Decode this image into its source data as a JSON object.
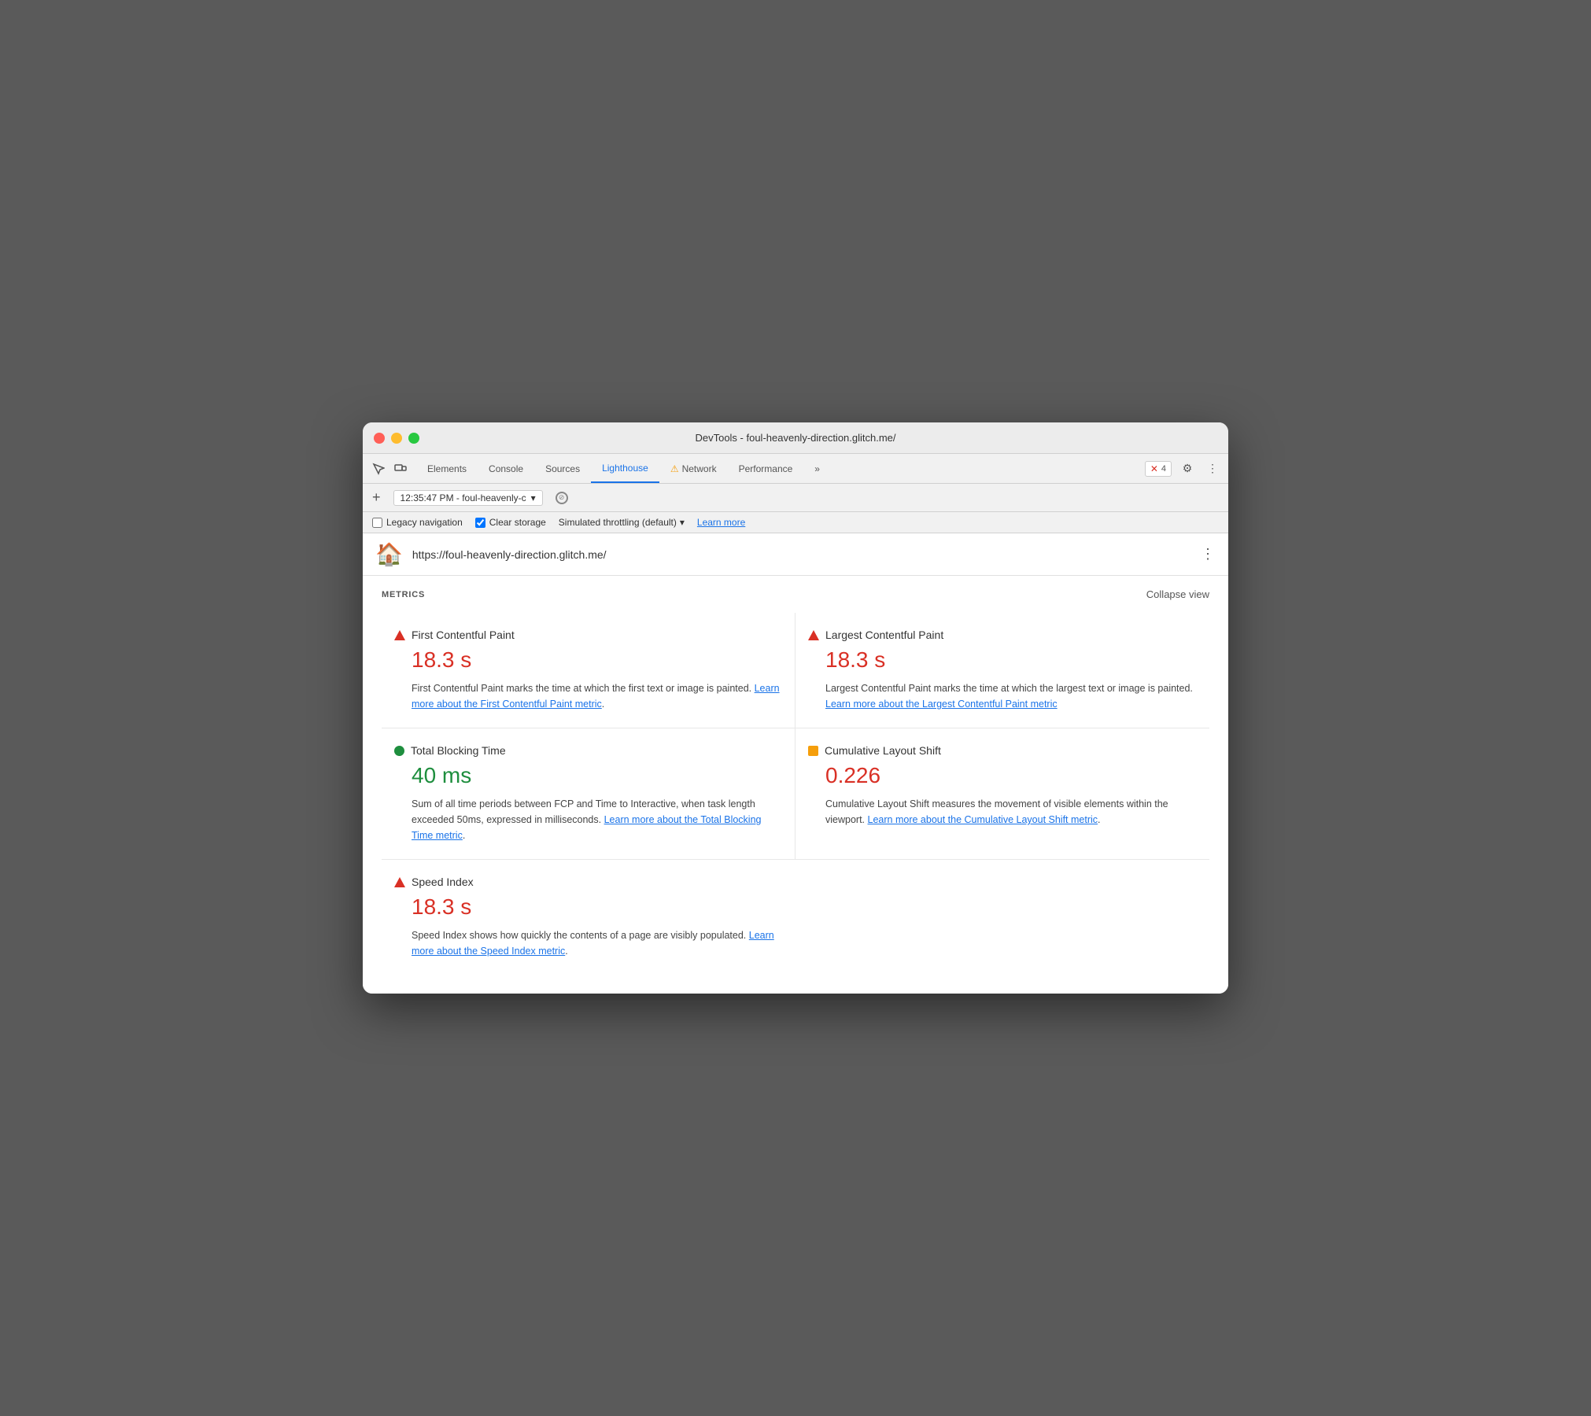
{
  "window": {
    "title": "DevTools - foul-heavenly-direction.glitch.me/"
  },
  "tabs": {
    "items": [
      {
        "label": "Elements",
        "active": false
      },
      {
        "label": "Console",
        "active": false
      },
      {
        "label": "Sources",
        "active": false
      },
      {
        "label": "Lighthouse",
        "active": true
      },
      {
        "label": "Network",
        "active": false,
        "warning": true
      },
      {
        "label": "Performance",
        "active": false
      },
      {
        "label": "»",
        "active": false
      }
    ],
    "error_count": "4"
  },
  "toolbar": {
    "timestamp": "12:35:47 PM - foul-heavenly-c",
    "add_label": "+",
    "more_tabs_label": "»"
  },
  "options": {
    "legacy_navigation_label": "Legacy navigation",
    "legacy_navigation_checked": false,
    "clear_storage_label": "Clear storage",
    "clear_storage_checked": true,
    "throttling_label": "Simulated throttling (default)",
    "learn_more_label": "Learn more"
  },
  "url_bar": {
    "url": "https://foul-heavenly-direction.glitch.me/"
  },
  "metrics": {
    "section_title": "METRICS",
    "collapse_label": "Collapse view",
    "items": [
      {
        "name": "First Contentful Paint",
        "value": "18.3 s",
        "status": "red",
        "indicator": "triangle-red",
        "description": "First Contentful Paint marks the time at which the first text or image is painted.",
        "link_text": "Learn more about the First Contentful Paint metric",
        "link": "#"
      },
      {
        "name": "Largest Contentful Paint",
        "value": "18.3 s",
        "status": "red",
        "indicator": "triangle-red",
        "description": "Largest Contentful Paint marks the time at which the largest text or image is painted.",
        "link_text": "Learn more about the Largest Contentful Paint metric",
        "link": "#"
      },
      {
        "name": "Total Blocking Time",
        "value": "40 ms",
        "status": "green",
        "indicator": "circle-green",
        "description": "Sum of all time periods between FCP and Time to Interactive, when task length exceeded 50ms, expressed in milliseconds.",
        "link_text": "Learn more about the Total Blocking Time metric",
        "link": "#"
      },
      {
        "name": "Cumulative Layout Shift",
        "value": "0.226",
        "status": "orange",
        "indicator": "square-orange",
        "description": "Cumulative Layout Shift measures the movement of visible elements within the viewport.",
        "link_text": "Learn more about the Cumulative Layout Shift metric",
        "link": "#"
      },
      {
        "name": "Speed Index",
        "value": "18.3 s",
        "status": "red",
        "indicator": "triangle-red",
        "description": "Speed Index shows how quickly the contents of a page are visibly populated.",
        "link_text": "Learn more about the Speed Index metric",
        "link": "#"
      }
    ]
  }
}
